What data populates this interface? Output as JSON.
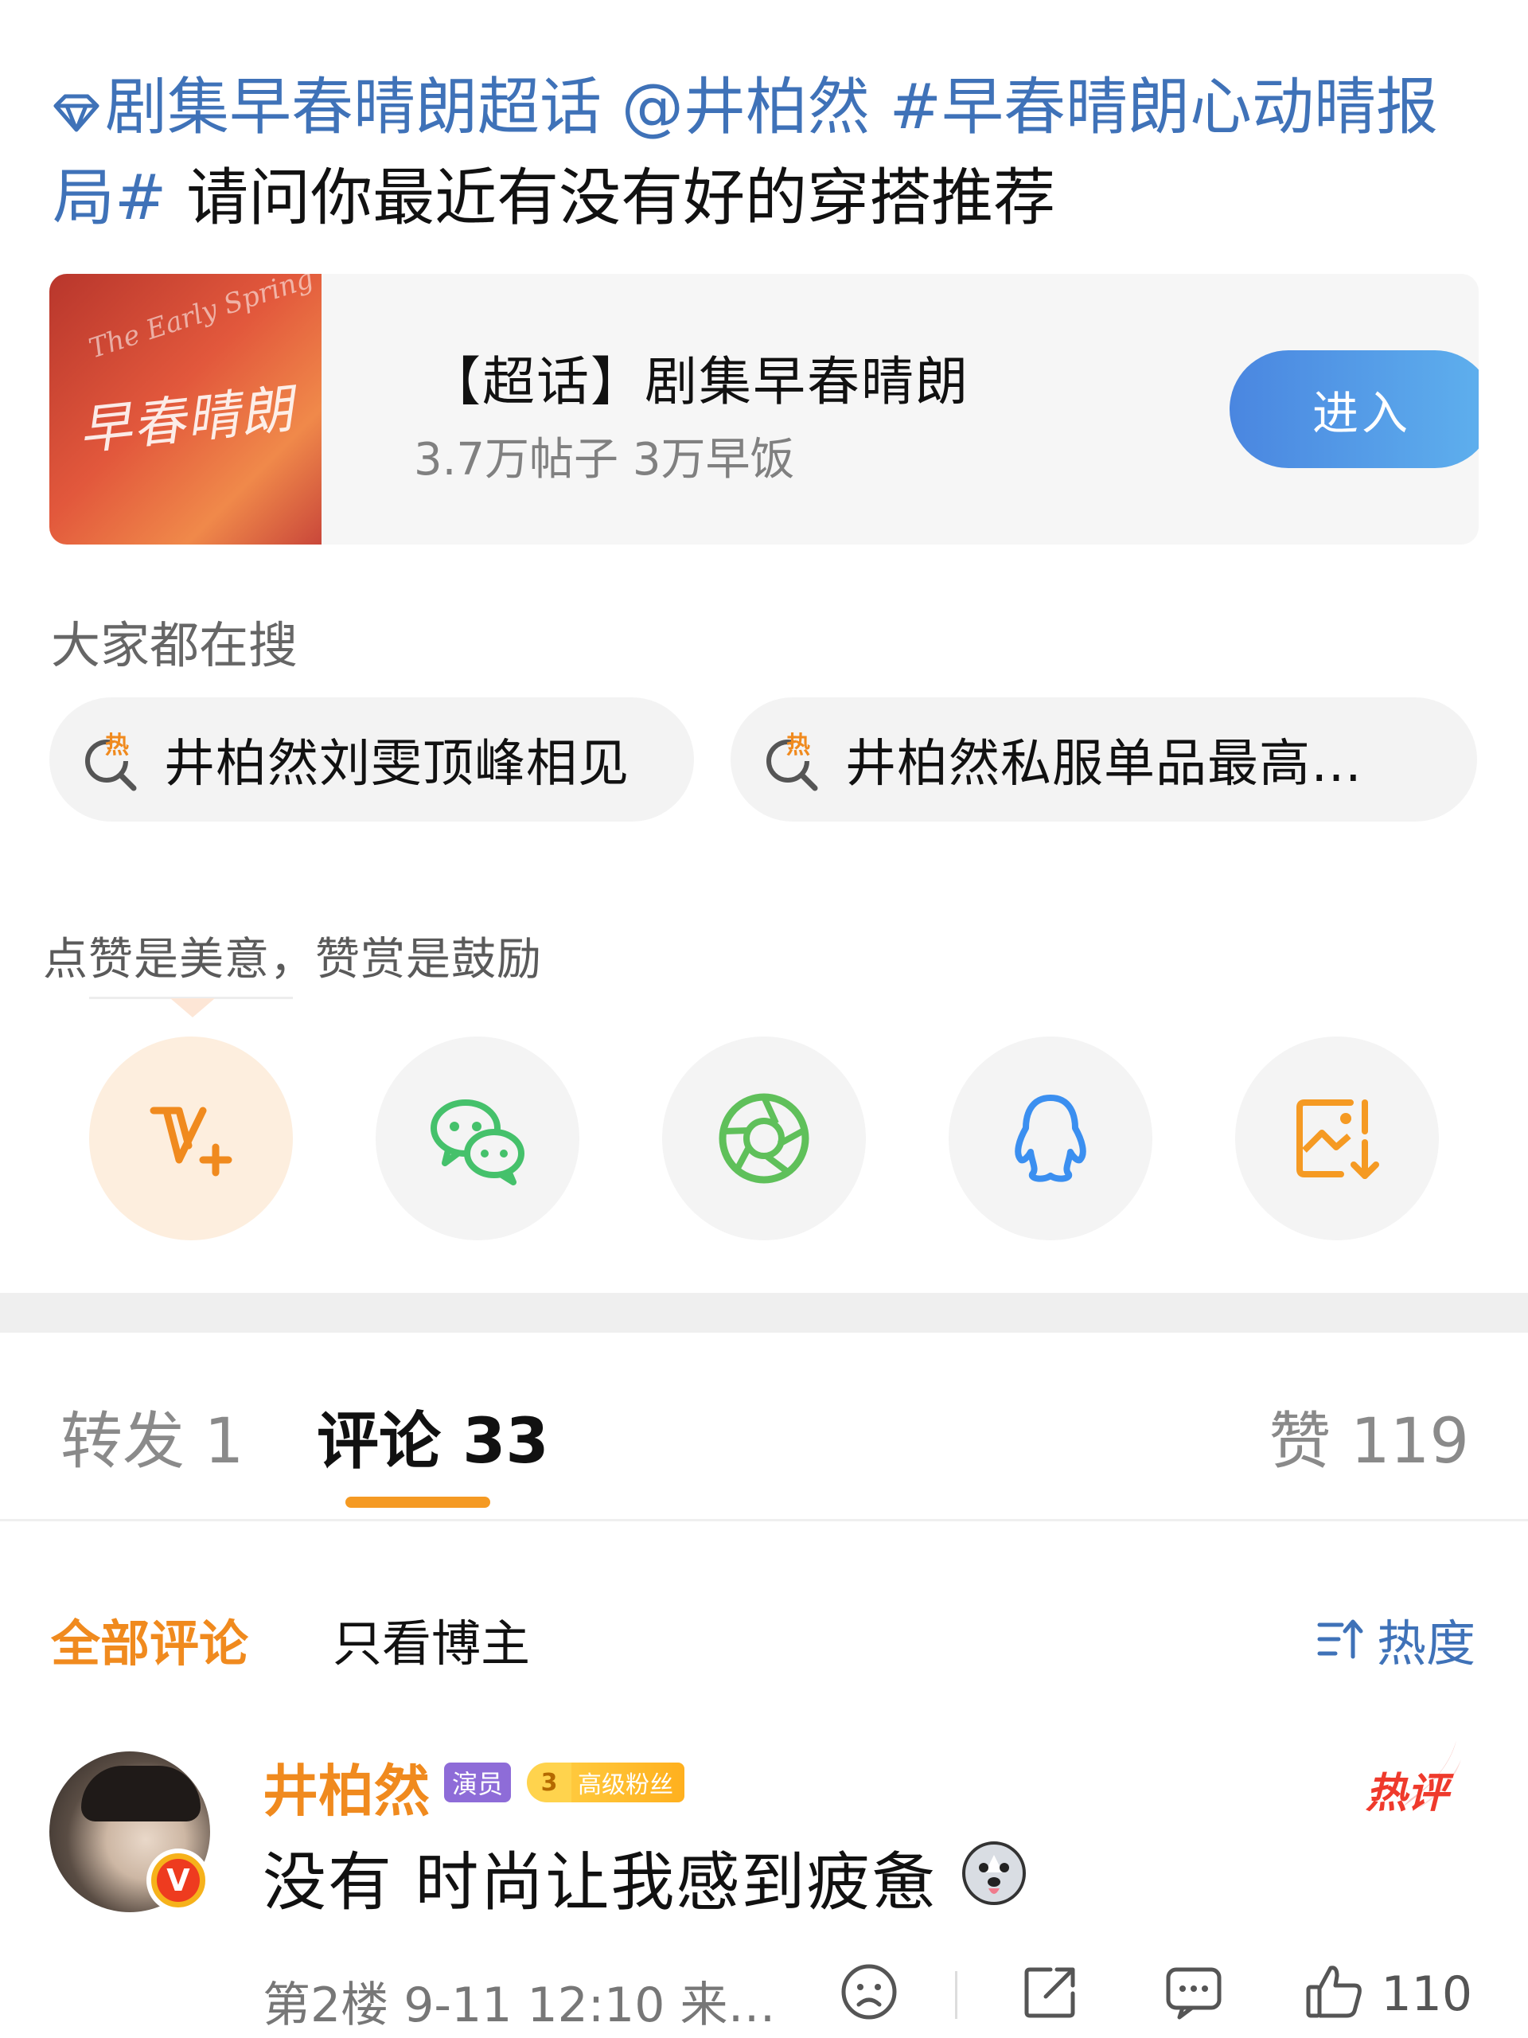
{
  "post": {
    "cut_top_text": "",
    "super_topic": "剧集早春晴朗超话",
    "mention": "@井柏然",
    "hashtag": "#早春晴朗心动晴报局#",
    "body": "请问你最近有没有好的穿搭推荐"
  },
  "topic_card": {
    "title": "【超话】剧集早春晴朗",
    "stats": "3.7万帖子 3万早饭",
    "enter_label": "进入",
    "cover_script": "早春晴朗",
    "cover_script_small": "The Early Spring"
  },
  "search": {
    "heading": "大家都在搜",
    "chips": [
      {
        "icon": "hot-search-icon",
        "text": "井柏然刘雯顶峰相见"
      },
      {
        "icon": "hot-search-icon",
        "text": "井柏然私服单品最高…"
      }
    ]
  },
  "tip": {
    "text": "点赞是美意，赞赏是鼓励"
  },
  "share": {
    "items": [
      {
        "icon": "vip-plus-icon",
        "color": "#f08a1e"
      },
      {
        "icon": "wechat-icon",
        "color": "#45c16b"
      },
      {
        "icon": "moments-icon",
        "color": "#5fc05a"
      },
      {
        "icon": "qq-icon",
        "color": "#3b8ff0"
      },
      {
        "icon": "save-image-icon",
        "color": "#f59a23"
      }
    ]
  },
  "tabs": {
    "repost": "转发 1",
    "comments": "评论 33",
    "likes": "赞 119",
    "active_color": "#f59a23"
  },
  "filter": {
    "all": "全部评论",
    "owner_only": "只看博主",
    "sort": "热度"
  },
  "comment": {
    "name": "井柏然",
    "role_badge": "演员",
    "fan_level": "3",
    "fan_label": "高级粉丝",
    "hot_badge": "热评",
    "text": "没有 时尚让我感到疲惫",
    "meta": "第2楼 9-11 12:10 来…",
    "likes": "110"
  }
}
